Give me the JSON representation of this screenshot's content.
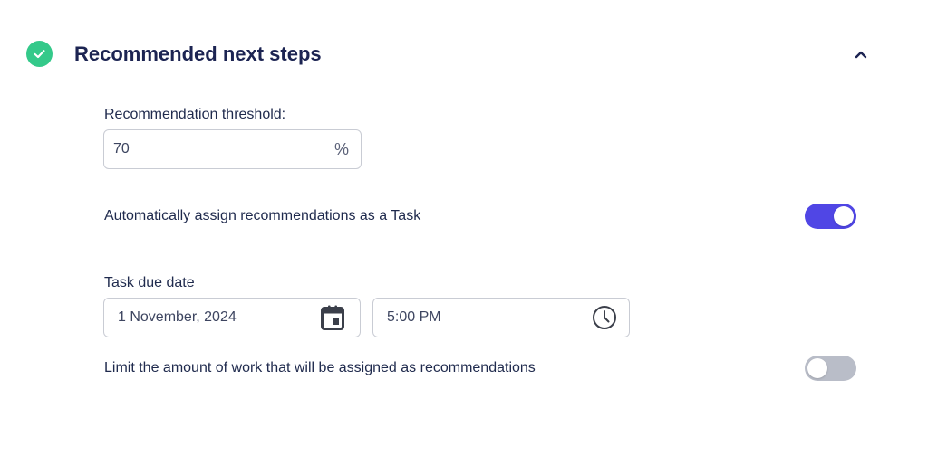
{
  "section": {
    "title": "Recommended next steps",
    "status_icon": "check-circle-icon",
    "collapse_icon": "chevron-up-icon",
    "status_color": "#34c98a"
  },
  "threshold": {
    "label": "Recommendation threshold:",
    "value": "70",
    "suffix": "%"
  },
  "auto_assign": {
    "label": "Automatically assign recommendations as a Task",
    "enabled": true,
    "on_color": "#5046e5"
  },
  "due_date": {
    "label": "Task due date",
    "date_value": "1 November, 2024",
    "date_icon": "calendar-icon",
    "time_value": "5:00 PM",
    "time_icon": "clock-icon"
  },
  "limit_work": {
    "label": "Limit the amount of work that will be assigned as recommendations",
    "enabled": false,
    "off_color": "#b9bdc8"
  }
}
